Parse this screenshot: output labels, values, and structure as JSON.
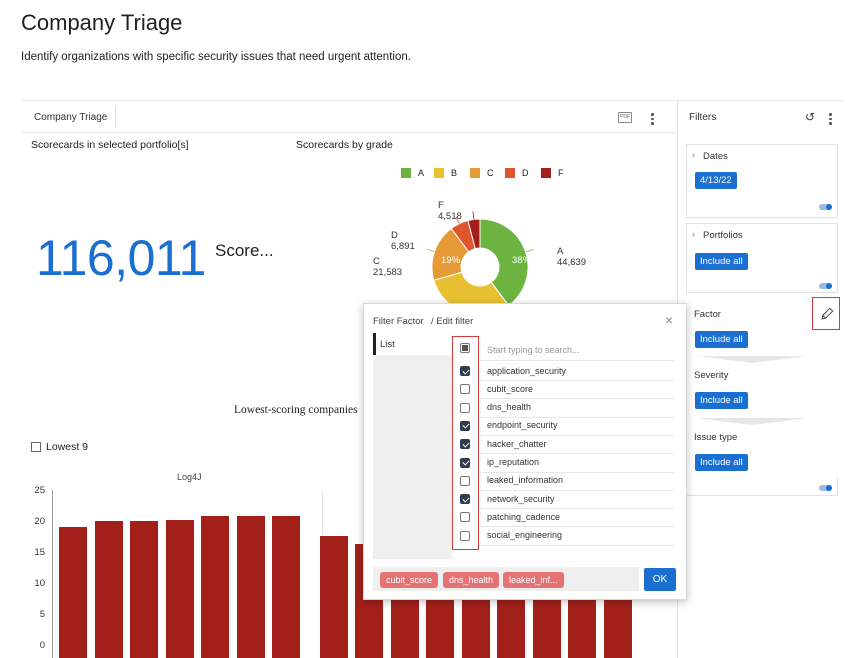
{
  "page": {
    "title": "Company Triage",
    "subtitle": "Identify organizations with specific security issues that need urgent attention."
  },
  "dashboard": {
    "tab_label": "Company Triage",
    "pdf_label": "PDF",
    "scorecards_portfolio_title": "Scorecards in selected portfolio[s]",
    "scorecards_count": "116,011",
    "scorecards_count_label": "Score...",
    "scorecards_grade_title": "Scorecards by grade",
    "lowest_title": "Lowest-scoring companies",
    "lowest_select_label": "Lowest 9"
  },
  "chart_data": [
    {
      "type": "pie",
      "title": "Scorecards by grade",
      "legend": [
        "A",
        "B",
        "C",
        "D",
        "F"
      ],
      "legend_position": "top",
      "colors": [
        "#6cb43f",
        "#e8c032",
        "#e59a35",
        "#e0542e",
        "#a3201a"
      ],
      "slices": [
        {
          "label": "A",
          "value": 44639,
          "percent_label": "38%"
        },
        {
          "label": "B",
          "value": 34380,
          "percent_label": ""
        },
        {
          "label": "C",
          "value": 21583,
          "percent_label": "19%"
        },
        {
          "label": "D",
          "value": 6891,
          "percent_label": ""
        },
        {
          "label": "F",
          "value": 4518,
          "percent_label": ""
        }
      ],
      "value_labels": [
        "44,639",
        "21,583",
        "6,891",
        "4,518"
      ]
    },
    {
      "type": "bar",
      "title": "Log4J",
      "ylim": [
        0,
        25
      ],
      "yticks": [
        "0",
        "5",
        "10",
        "15",
        "20",
        "25"
      ],
      "values": [
        19.2,
        20.1,
        20.1,
        20.3,
        21.0,
        21.0,
        21.0,
        17.8,
        16.5,
        16.5,
        16.5,
        16.5,
        16.5,
        16.5,
        16.5,
        16.5
      ],
      "color": "#a3201a"
    }
  ],
  "filters": {
    "title": "Filters",
    "dates_label": "Dates",
    "dates_value": "4/13/22",
    "portfolios_label": "Portfolios",
    "portfolios_value": "Include all",
    "factor_label": "Factor",
    "factor_value": "Include all",
    "severity_label": "Severity",
    "severity_value": "Include all",
    "issue_type_label": "Issue type",
    "issue_type_value": "Include all"
  },
  "modal": {
    "title": "Filter Factor",
    "subtitle": "/ Edit filter",
    "left_tab": "List",
    "search_placeholder": "Start typing to search...",
    "options": [
      {
        "label": "application_security",
        "checked": true
      },
      {
        "label": "cubit_score",
        "checked": false
      },
      {
        "label": "dns_health",
        "checked": false
      },
      {
        "label": "endpoint_security",
        "checked": true
      },
      {
        "label": "hacker_chatter",
        "checked": true
      },
      {
        "label": "ip_reputation",
        "checked": true
      },
      {
        "label": "leaked_information",
        "checked": false
      },
      {
        "label": "network_security",
        "checked": true
      },
      {
        "label": "patching_cadence",
        "checked": false
      },
      {
        "label": "social_engineering",
        "checked": false
      }
    ],
    "chips": [
      "cubit_score",
      "dns_health",
      "leaked_inf..."
    ],
    "ok_label": "OK"
  }
}
